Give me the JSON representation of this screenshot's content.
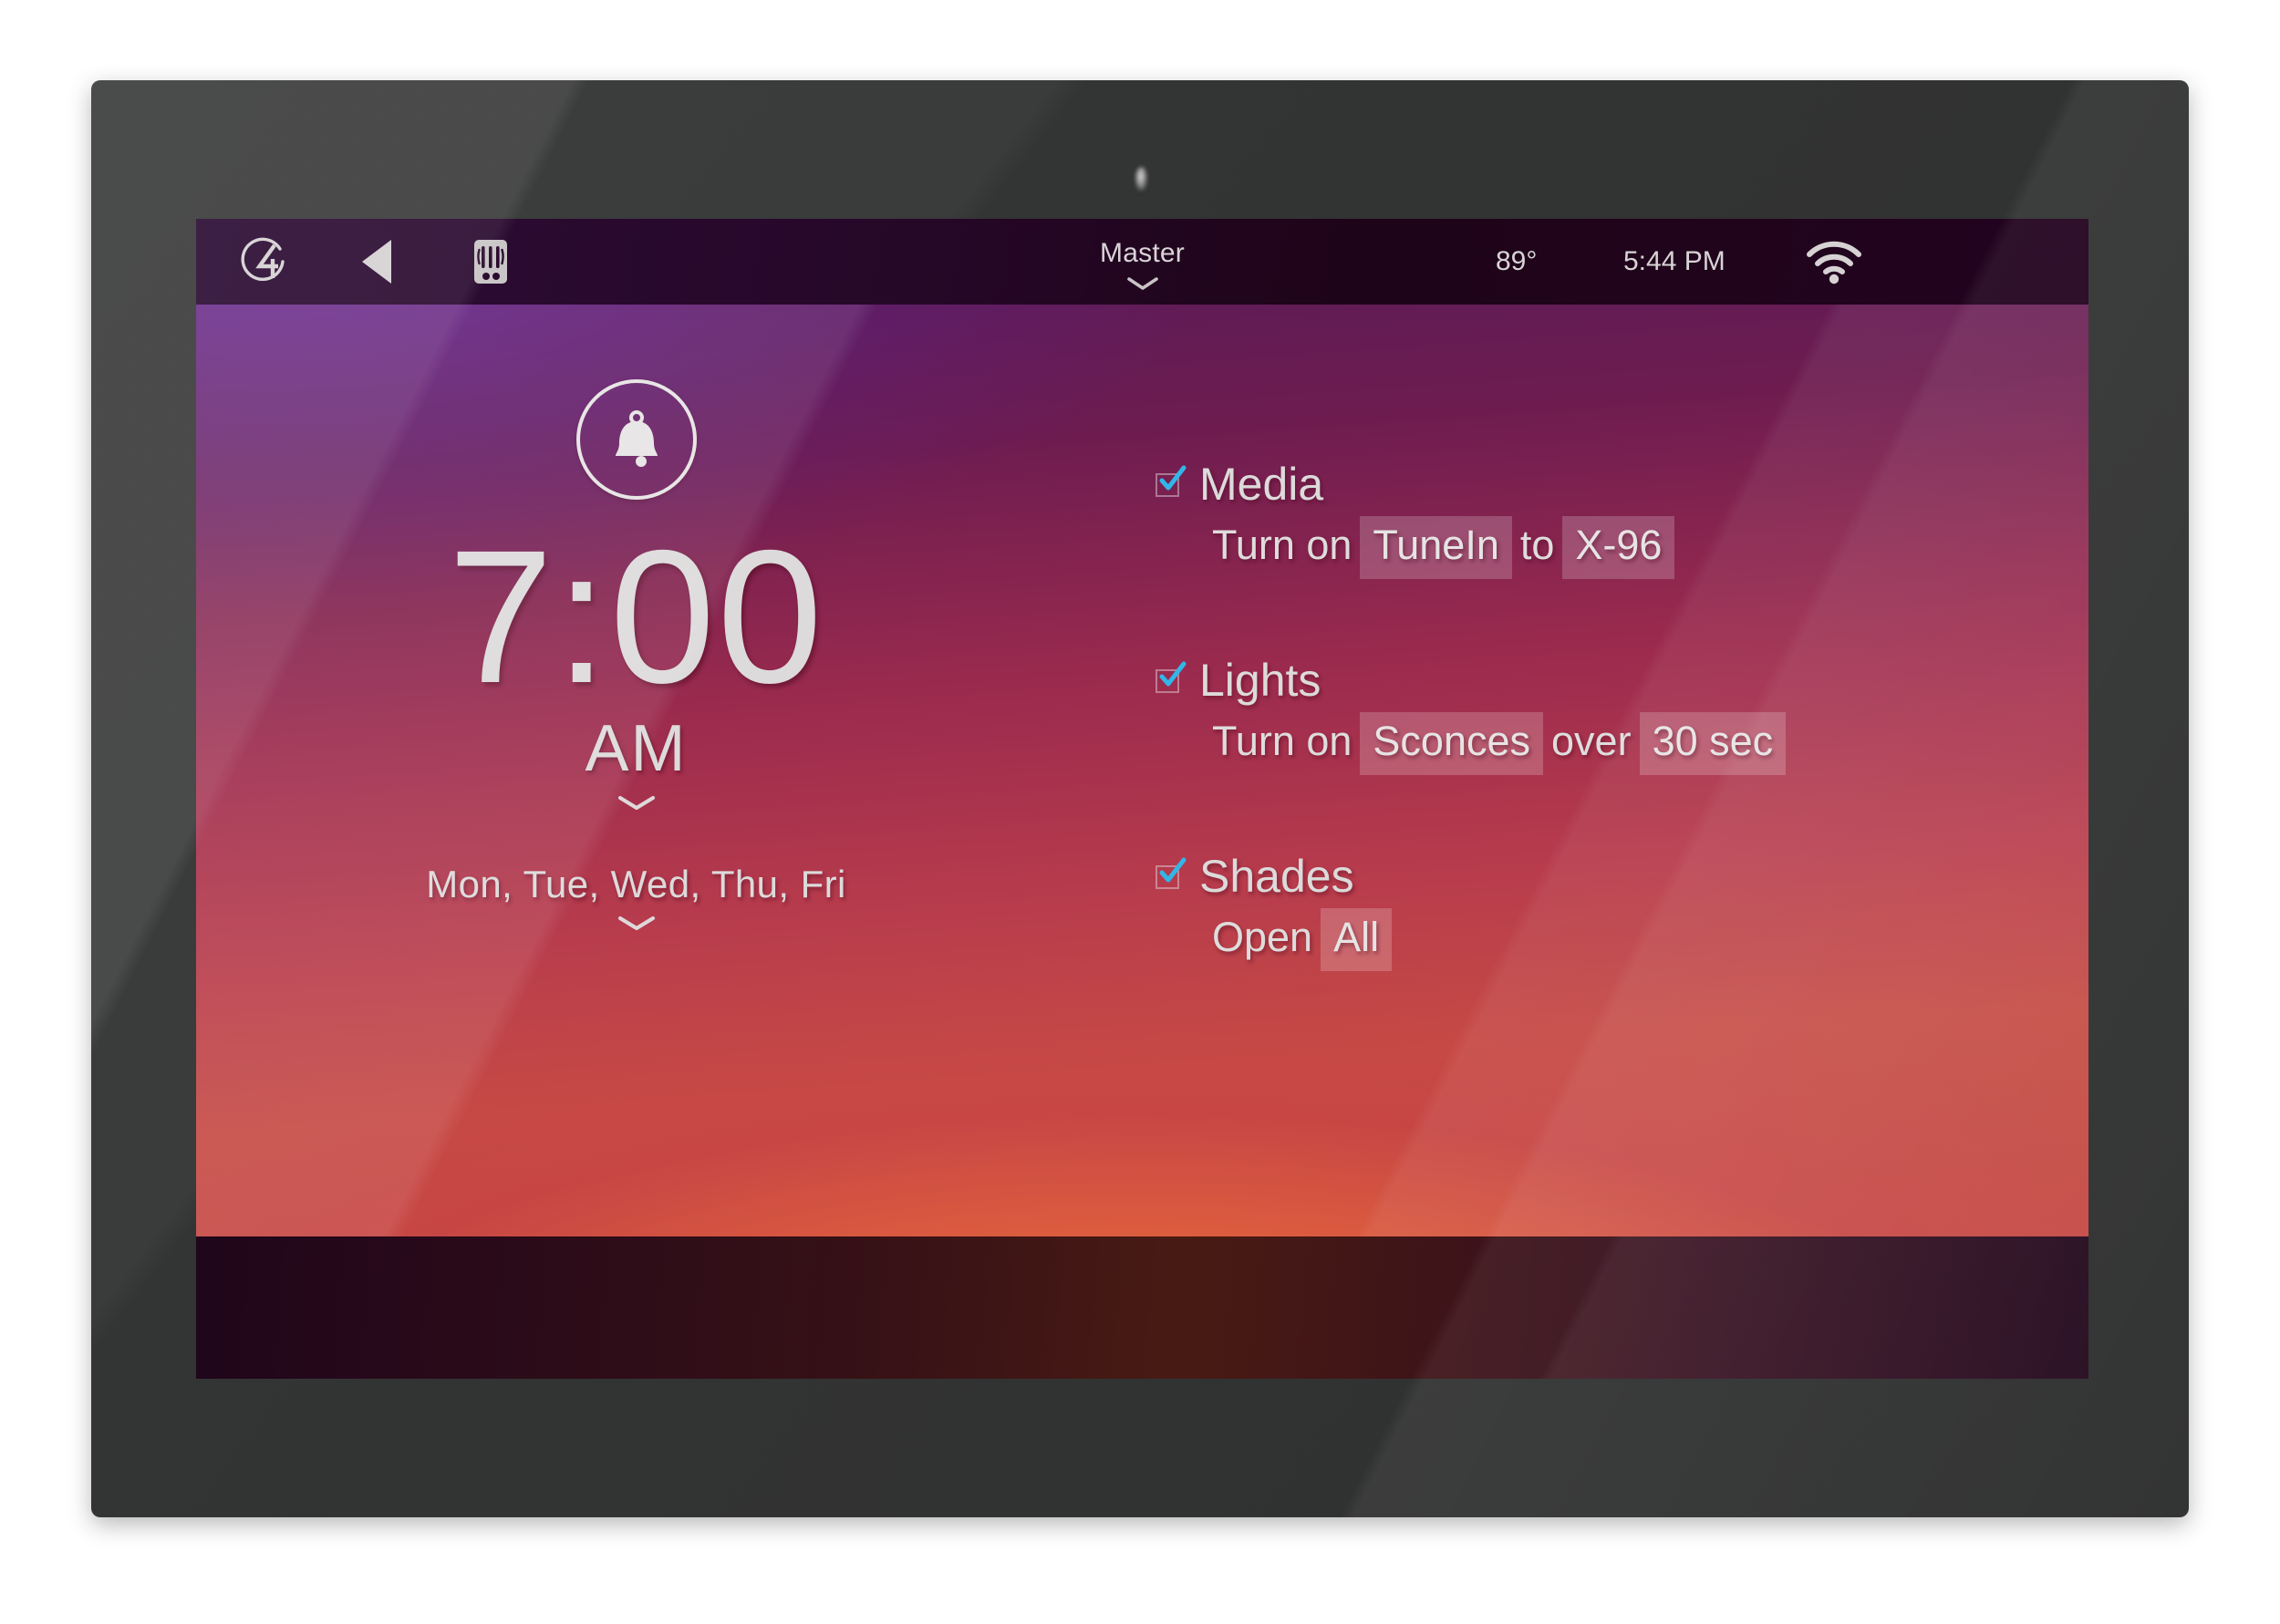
{
  "device": {
    "kind": "touchscreen-panel",
    "bezel_color": "#343535",
    "camera": "front-camera"
  },
  "statusbar": {
    "logo": "control4-logo-icon",
    "back": "back-arrow-icon",
    "intercom": "intercom-icon",
    "room": "Master",
    "room_chevron": "chevron-down-icon",
    "temperature": "89°",
    "time": "5:44 PM",
    "wifi": "wifi-icon"
  },
  "alarm": {
    "bell_icon": "alarm-bell-icon",
    "time": "7:00",
    "meridiem": "AM",
    "meridiem_chevron": "chevron-down-icon",
    "days": "Mon, Tue, Wed, Thu, Fri",
    "days_chevron": "chevron-down-icon"
  },
  "actions": [
    {
      "id": "media",
      "title": "Media",
      "checked": true,
      "detail": [
        {
          "type": "text",
          "value": "Turn on"
        },
        {
          "type": "chip",
          "value": "TuneIn"
        },
        {
          "type": "text",
          "value": "to"
        },
        {
          "type": "chip",
          "value": "X-96"
        }
      ]
    },
    {
      "id": "lights",
      "title": "Lights",
      "checked": true,
      "detail": [
        {
          "type": "text",
          "value": "Turn on"
        },
        {
          "type": "chip",
          "value": "Sconces"
        },
        {
          "type": "text",
          "value": "over"
        },
        {
          "type": "chip",
          "value": "30 sec"
        }
      ]
    },
    {
      "id": "shades",
      "title": "Shades",
      "checked": true,
      "detail": [
        {
          "type": "text",
          "value": "Open"
        },
        {
          "type": "chip",
          "value": "All"
        }
      ]
    }
  ],
  "colors": {
    "accent_check": "#32b6e8",
    "text": "#dcdada",
    "chip_bg": "rgba(255,255,255,0.20)",
    "statusbar_bg": "#27082b",
    "wallpaper_top": "#5a1b58",
    "wallpaper_bottom": "#e8703c"
  }
}
